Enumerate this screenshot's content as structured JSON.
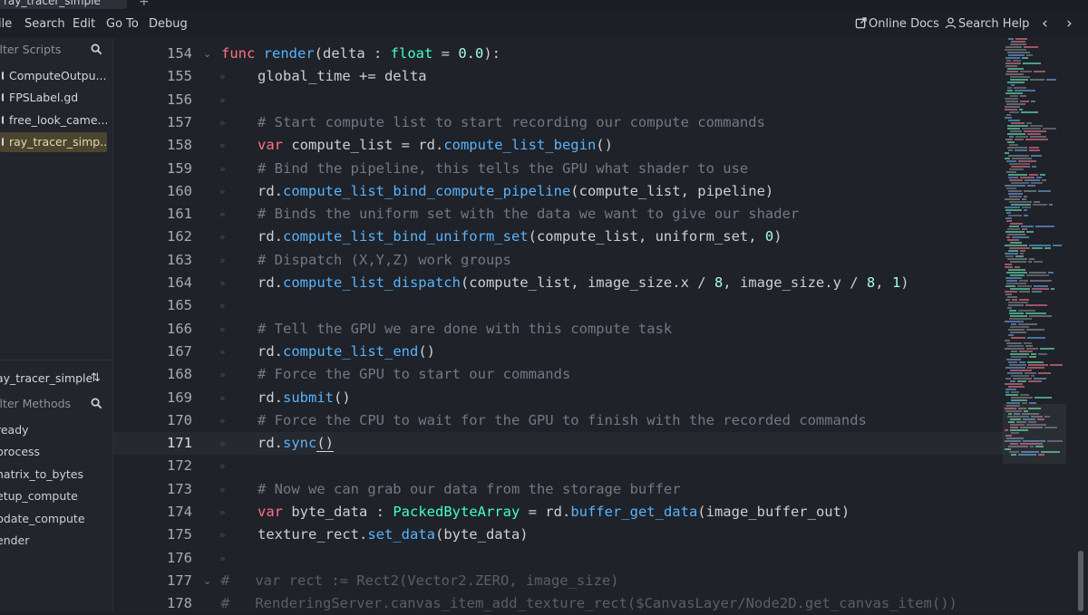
{
  "tabs": {
    "active": "ray_tracer_simple",
    "add": "+"
  },
  "menu": [
    "ile",
    "Search",
    "Edit",
    "Go To",
    "Debug"
  ],
  "help": {
    "online_docs": "Online Docs",
    "search_help": "Search Help",
    "back": "‹",
    "forward": "›"
  },
  "scripts": {
    "filter_placeholder": "ilter Scripts",
    "items": [
      "ComputeOutpu...",
      "FPSLabel.gd",
      "free_look_came...",
      "ray_tracer_simp..."
    ],
    "selected_index": 3
  },
  "methods": {
    "current_script": "ay_tracer_simple",
    "filter_placeholder": "ilter Methods",
    "items": [
      "ready",
      "process",
      "natrix_to_bytes",
      "etup_compute",
      "pdate_compute",
      "ender"
    ]
  },
  "editor": {
    "current_line": 171,
    "lines": [
      {
        "n": 154,
        "text": "func render(delta : float = 0.0):"
      },
      {
        "n": 155,
        "text": "global_time += delta"
      },
      {
        "n": 156,
        "text": ""
      },
      {
        "n": 157,
        "text": "# Start compute list to start recording our compute commands"
      },
      {
        "n": 158,
        "text": "var compute_list = rd.compute_list_begin()"
      },
      {
        "n": 159,
        "text": "# Bind the pipeline, this tells the GPU what shader to use"
      },
      {
        "n": 160,
        "text": "rd.compute_list_bind_compute_pipeline(compute_list, pipeline)"
      },
      {
        "n": 161,
        "text": "# Binds the uniform set with the data we want to give our shader"
      },
      {
        "n": 162,
        "text": "rd.compute_list_bind_uniform_set(compute_list, uniform_set, 0)"
      },
      {
        "n": 163,
        "text": "# Dispatch (X,Y,Z) work groups"
      },
      {
        "n": 164,
        "text": "rd.compute_list_dispatch(compute_list, image_size.x / 8, image_size.y / 8, 1)"
      },
      {
        "n": 165,
        "text": ""
      },
      {
        "n": 166,
        "text": "# Tell the GPU we are done with this compute task"
      },
      {
        "n": 167,
        "text": "rd.compute_list_end()"
      },
      {
        "n": 168,
        "text": "# Force the GPU to start our commands"
      },
      {
        "n": 169,
        "text": "rd.submit()"
      },
      {
        "n": 170,
        "text": "# Force the CPU to wait for the GPU to finish with the recorded commands"
      },
      {
        "n": 171,
        "text": "rd.sync()"
      },
      {
        "n": 172,
        "text": ""
      },
      {
        "n": 173,
        "text": "# Now we can grab our data from the storage buffer"
      },
      {
        "n": 174,
        "text": "var byte_data : PackedByteArray = rd.buffer_get_data(image_buffer_out)"
      },
      {
        "n": 175,
        "text": "texture_rect.set_data(byte_data)"
      },
      {
        "n": 176,
        "text": ""
      },
      {
        "n": 177,
        "text": "#   var rect := Rect2(Vector2.ZERO, image_size)"
      },
      {
        "n": 178,
        "text": "#   RenderingServer.canvas_item_add_texture_rect($CanvasLayer/Node2D.get_canvas_item())"
      }
    ]
  }
}
